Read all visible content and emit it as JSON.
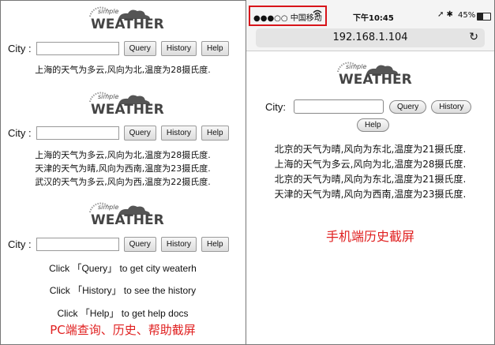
{
  "logo": {
    "small": "simple",
    "big": "WEATHER"
  },
  "pc": {
    "city_label": "City :",
    "query_label": "Query",
    "history_label": "History",
    "help_label": "Help",
    "section1_results": [
      "上海的天气为多云,风向为北,温度为28摄氏度."
    ],
    "section2_results": [
      "上海的天气为多云,风向为北,温度为28摄氏度.",
      "天津的天气为晴,风向为西南,温度为23摄氏度.",
      "武汉的天气为多云,风向为西,温度为22摄氏度."
    ],
    "help_lines": [
      "Click 「Query」 to get city weaterh",
      "Click 「History」 to see the history",
      "Click 「Help」 to get help docs"
    ],
    "caption": "PC端查询、历史、帮助截屏"
  },
  "mobile": {
    "carrier": "●●●○○ 中国移动",
    "time": "下午10:45",
    "battery": "45%",
    "url": "192.168.1.104",
    "city_label": "City:",
    "query_label": "Query",
    "history_label": "History",
    "help_label": "Help",
    "results": [
      "北京的天气为晴,风向为东北,温度为21摄氏度.",
      "上海的天气为多云,风向为北,温度为28摄氏度.",
      "北京的天气为晴,风向为东北,温度为21摄氏度.",
      "天津的天气为晴,风向为西南,温度为23摄氏度."
    ],
    "caption": "手机端历史截屏"
  },
  "colors": {
    "caption_red": "#e02020",
    "highlight_box": "#d8141a"
  }
}
